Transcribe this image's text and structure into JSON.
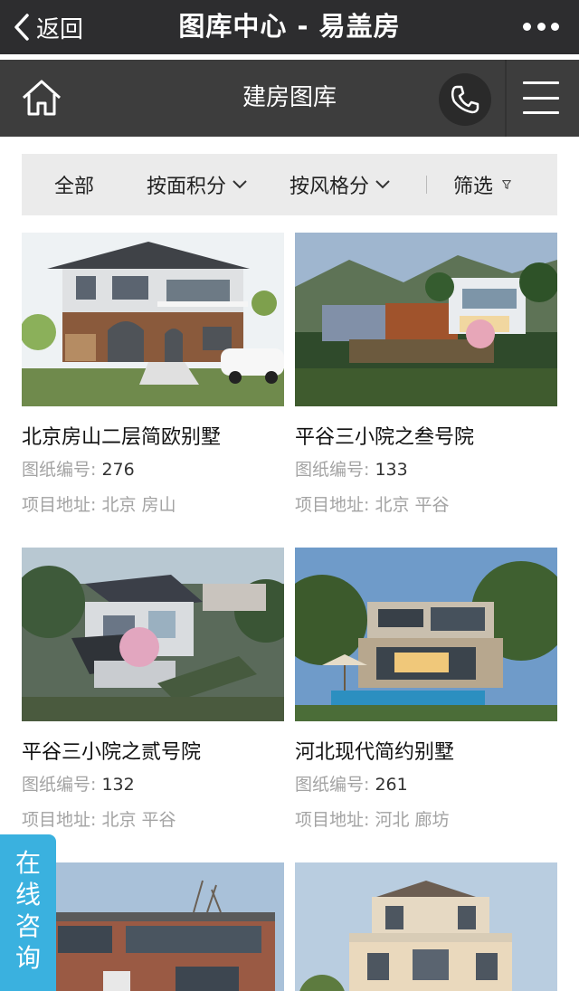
{
  "topbar": {
    "back_label": "返回",
    "title": "图库中心 - 易盖房"
  },
  "navbar": {
    "title": "建房图库"
  },
  "filters": {
    "all": "全部",
    "by_area": "按面积分",
    "by_style": "按风格分",
    "filter": "筛选"
  },
  "labels": {
    "drawing_no": "图纸编号:",
    "address": "项目地址:"
  },
  "cards": [
    {
      "name": "北京房山二层简欧别墅",
      "drawing_no": "276",
      "address": "北京 房山"
    },
    {
      "name": "平谷三小院之叁号院",
      "drawing_no": "133",
      "address": "北京 平谷"
    },
    {
      "name": "平谷三小院之贰号院",
      "drawing_no": "132",
      "address": "北京 平谷"
    },
    {
      "name": "河北现代简约别墅",
      "drawing_no": "261",
      "address": "河北 廊坊"
    }
  ],
  "consult": {
    "chars": [
      "在",
      "线",
      "咨",
      "询"
    ]
  },
  "icons": [
    "back-chevron-icon",
    "more-icon",
    "home-icon",
    "phone-icon",
    "menu-icon",
    "chevron-down-icon",
    "filter-funnel-icon"
  ],
  "colors": {
    "topbar": "#2d2d2f",
    "navbar": "#3d3d3d",
    "filter_bg": "#ebebeb",
    "consult": "#3ab1df"
  }
}
